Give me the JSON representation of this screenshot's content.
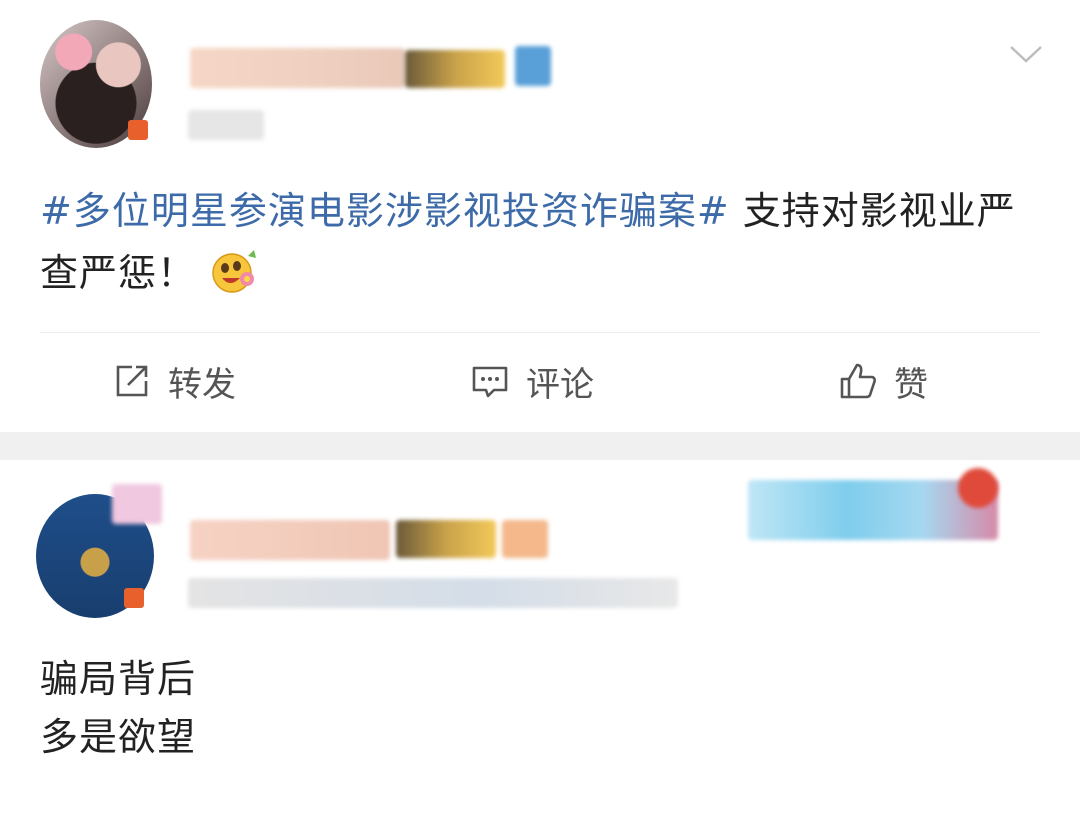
{
  "post": {
    "topic": "#多位明星参演电影涉影视投资诈骗案#",
    "text": " 支持对影视业严查严惩！",
    "actions": {
      "repost_label": "转发",
      "comment_label": "评论",
      "like_label": "赞"
    }
  },
  "comment": {
    "line1": "骗局背后",
    "line2": "多是欲望"
  },
  "colors": {
    "topic": "#3d6aa8",
    "text": "#222222",
    "action_text": "#555555",
    "separator_band": "#f0f0f0"
  },
  "icons": {
    "expand": "chevron-down-icon",
    "repost": "repost-icon",
    "comment": "comment-icon",
    "like": "thumbs-up-icon",
    "emoji": "flower-smile-emoji"
  }
}
